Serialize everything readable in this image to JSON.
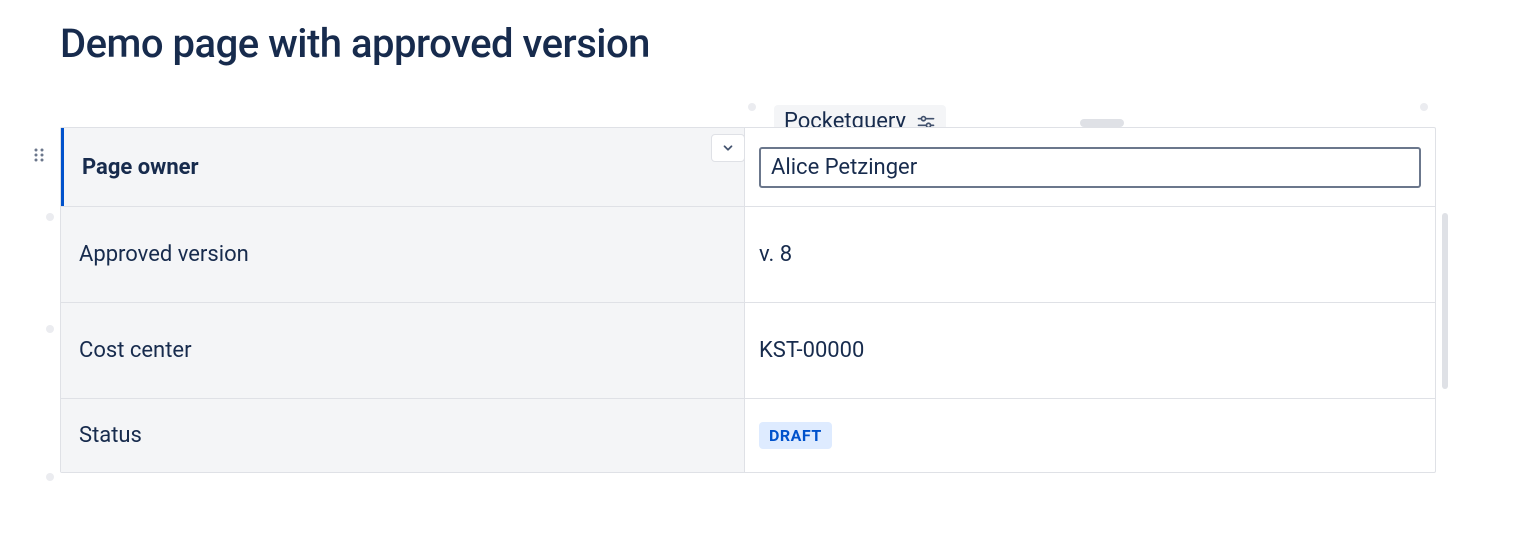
{
  "page": {
    "title": "Demo page with approved version"
  },
  "macro": {
    "name": "Pocketquery"
  },
  "properties": {
    "page_owner": {
      "label": "Page owner",
      "value": "Alice Petzinger"
    },
    "approved_version": {
      "label": "Approved version",
      "value": "v. 8"
    },
    "cost_center": {
      "label": "Cost center",
      "value": "KST-00000"
    },
    "status": {
      "label": "Status",
      "badge": "DRAFT"
    }
  }
}
